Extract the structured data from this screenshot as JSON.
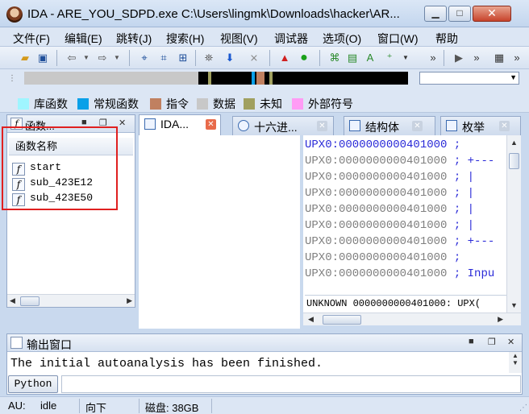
{
  "window": {
    "title": "IDA - ARE_YOU_SDPD.exe C:\\Users\\lingmk\\Downloads\\hacker\\AR...",
    "min_label": "▁",
    "max_label": "□",
    "close_label": "✕"
  },
  "menu": [
    "文件(F)",
    "编辑(E)",
    "跳转(J)",
    "搜索(H)",
    "视图(V)",
    "调试器",
    "选项(O)",
    "窗口(W)",
    "帮助"
  ],
  "legend": [
    {
      "label": "库函数",
      "color": "#9ff5ff"
    },
    {
      "label": "常规函数",
      "color": "#0aa0e8"
    },
    {
      "label": "指令",
      "color": "#c08060"
    },
    {
      "label": "数据",
      "color": "#c8c8c8"
    },
    {
      "label": "未知",
      "color": "#a0a060"
    },
    {
      "label": "外部符号",
      "color": "#ff9cf5"
    }
  ],
  "functions_panel": {
    "tab_label": "函数...",
    "header": "函数名称",
    "items": [
      "start",
      "sub_423E12",
      "sub_423E50"
    ]
  },
  "tabs": [
    {
      "label": "IDA...",
      "active": true
    },
    {
      "label": "十六进...",
      "active": false
    },
    {
      "label": "结构体",
      "active": false
    },
    {
      "label": "枚举",
      "active": false
    }
  ],
  "listing": {
    "lines": [
      {
        "addr": "UPX0:0000000000401000",
        "comment": ";",
        "grey": false
      },
      {
        "addr": "UPX0:0000000000401000",
        "comment": "; +---",
        "grey": true
      },
      {
        "addr": "UPX0:0000000000401000",
        "comment": "; |",
        "grey": true
      },
      {
        "addr": "UPX0:0000000000401000",
        "comment": "; |",
        "grey": true
      },
      {
        "addr": "UPX0:0000000000401000",
        "comment": "; |",
        "grey": true
      },
      {
        "addr": "UPX0:0000000000401000",
        "comment": "; |",
        "grey": true
      },
      {
        "addr": "UPX0:0000000000401000",
        "comment": "; +---",
        "grey": true
      },
      {
        "addr": "UPX0:0000000000401000",
        "comment": ";",
        "grey": true
      },
      {
        "addr": "UPX0:0000000000401000",
        "comment": "; Inpu",
        "grey": true
      }
    ],
    "status": "UNKNOWN 0000000000401000: UPX("
  },
  "output": {
    "title": "输出窗口",
    "text": "The initial autoanalysis has been finished.",
    "python_label": "Python"
  },
  "status": {
    "au_label": "AU:",
    "au_value": "idle",
    "direction": "向下",
    "disk": "磁盘: 38GB"
  }
}
